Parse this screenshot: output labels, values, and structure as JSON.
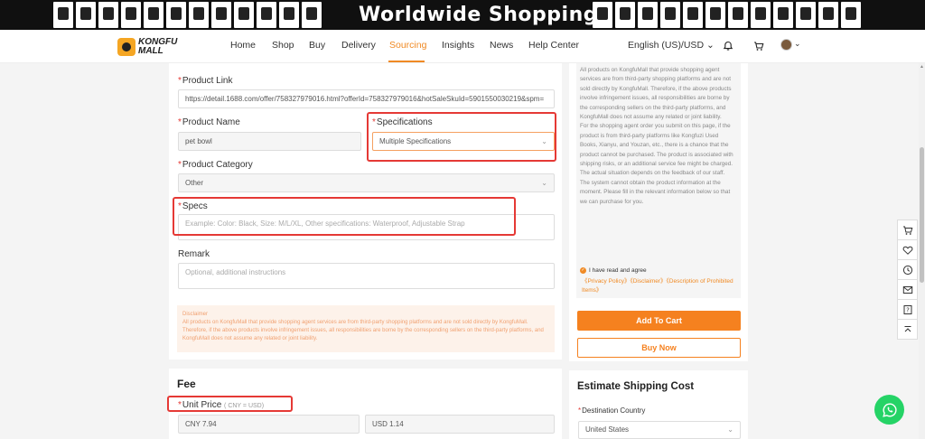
{
  "banner": {
    "title": "Worldwide Shopping"
  },
  "nav": {
    "logo_line1": "KONGFU",
    "logo_line2": "MALL",
    "items": [
      "Home",
      "Shop",
      "Buy",
      "Delivery",
      "Sourcing",
      "Insights",
      "News",
      "Help Center"
    ],
    "active": "Sourcing",
    "language": "English (US)/USD",
    "icons": [
      "bell-icon",
      "cart-icon",
      "avatar"
    ]
  },
  "form": {
    "product_link": {
      "label": "Product Link",
      "value": "https://detail.1688.com/offer/758327979016.html?offerId=758327979016&hotSaleSkuId=5901550030219&spm="
    },
    "product_name": {
      "label": "Product Name",
      "value": "pet bowl"
    },
    "specifications": {
      "label": "Specifications",
      "value": "Multiple Specifications"
    },
    "product_category": {
      "label": "Product Category",
      "value": "Other"
    },
    "specs": {
      "label": "Specs",
      "placeholder": "Example: Color: Black, Size: M/L/XL, Other specifications: Waterproof, Adjustable Strap"
    },
    "remark": {
      "label": "Remark",
      "placeholder": "Optional, additional instructions"
    },
    "disclaimer": {
      "title": "Disclaimer",
      "text": "All products on KongfuMall that provide shopping agent services are from third-party shopping platforms and are not sold directly by KongfuMall. Therefore, if the above products involve infringement issues, all responsibilities are borne by the corresponding sellers on the third-party platforms, and KongfuMall does not assume any related or joint liability."
    }
  },
  "fee": {
    "title": "Fee",
    "unit_price_label": "Unit Price",
    "unit_price_sub": "( CNY = USD)",
    "cny_value": "CNY 7.94",
    "usd_value": "USD 1.14"
  },
  "right_panel": {
    "notice_p1": "All products on KongfuMall that provide shopping agent services are from third-party shopping platforms and are not sold directly by KongfuMall. Therefore, if the above products involve infringement issues, all responsibilities are borne by the corresponding sellers on the third-party platforms, and KongfuMall does not assume any related or joint liability.",
    "notice_p2": "For the shopping agent order you submit on this page, if the product is from third-party platforms like Kongfuzi Used Books, Xianyu, and Youzan, etc., there is a chance that the product cannot be purchased. The product is associated with shipping risks, or an additional service fee might be charged. The actual situation depends on the feedback of our staff.",
    "notice_p3": "The system cannot obtain the product information at the moment. Please fill in the relevant information below so that we can purchase for you.",
    "agree_text": "I have read and agree",
    "agree_links": "《Privacy Policy》《Disclaimer》《Description of Prohibited Items》",
    "add_to_cart": "Add To Cart",
    "buy_now": "Buy Now",
    "shipping_title": "Estimate Shipping Cost",
    "destination_label": "Destination Country",
    "destination_value": "United States"
  },
  "side_toolbar": [
    "cart-icon",
    "heart-icon",
    "clock-icon",
    "mail-icon",
    "help-icon",
    "top-icon"
  ],
  "colors": {
    "accent": "#f5811f",
    "required": "#e53935",
    "whatsapp": "#25d366"
  }
}
